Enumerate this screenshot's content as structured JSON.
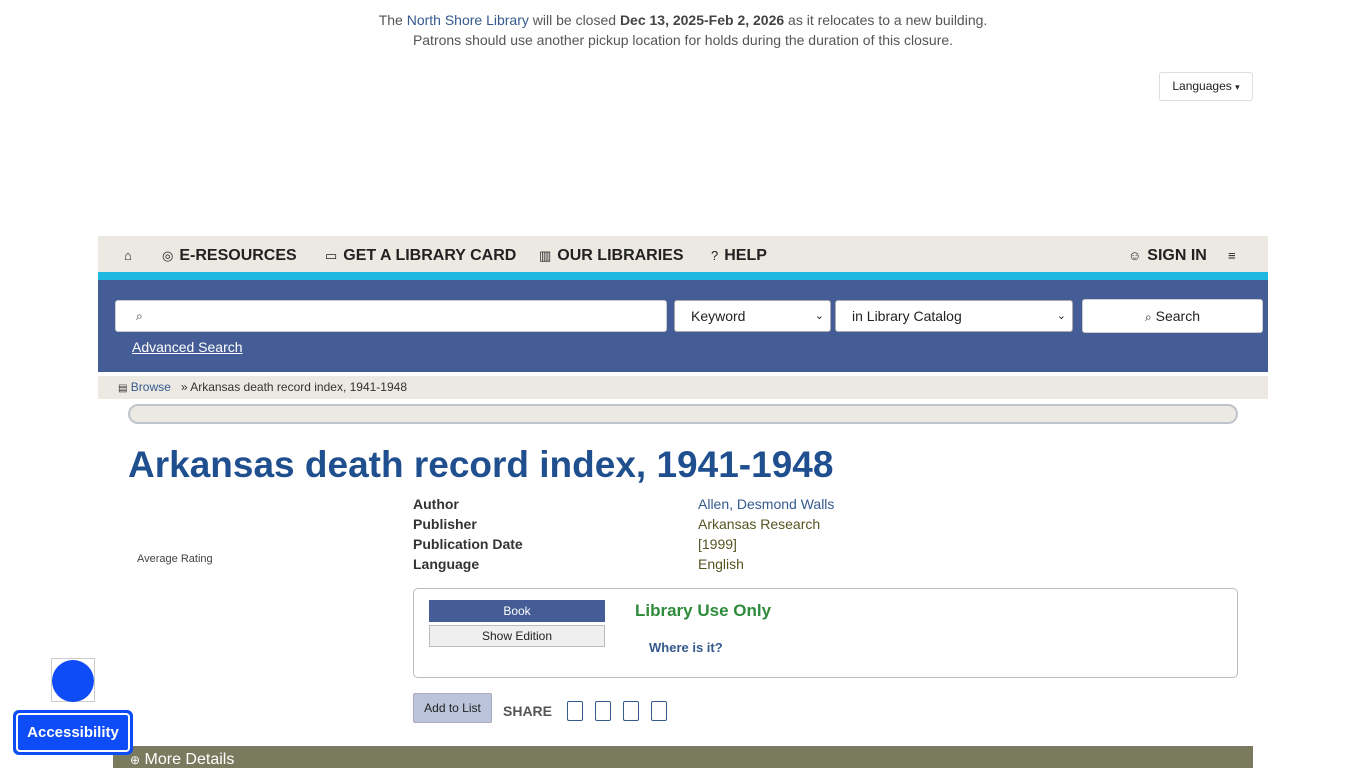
{
  "notice": {
    "line1_prefix": "The ",
    "line1_link": "North Shore Library",
    "line1_mid": " will be closed ",
    "line1_dates": "Dec 13, 2025-Feb 2, 2026",
    "line1_suffix": " as it relocates to a new building.",
    "line2": "Patrons should use another pickup location for holds during the duration of this closure."
  },
  "languages_label": "Languages",
  "nav": {
    "items": [
      {
        "label": "",
        "icon": "home-icon"
      },
      {
        "label": "E-RESOURCES",
        "icon": "globe-icon"
      },
      {
        "label": "GET A LIBRARY CARD",
        "icon": "card-icon"
      },
      {
        "label": "OUR LIBRARIES",
        "icon": "building-icon"
      },
      {
        "label": "HELP",
        "icon": "help-icon"
      }
    ],
    "sign_in": "SIGN IN",
    "extra_icon": "menu-icon"
  },
  "search": {
    "input_value": "",
    "search_type": "Keyword",
    "search_scope": "in Library Catalog",
    "button_label": "Search",
    "advanced_label": "Advanced Search"
  },
  "breadcrumb": {
    "browse": "Browse",
    "separator": "»",
    "current": "Arkansas death record index, 1941-1948"
  },
  "record": {
    "title": "Arkansas death record index, 1941-1948",
    "average_rating_label": "Average Rating",
    "fields": [
      {
        "label": "Author",
        "value": "Allen, Desmond Walls",
        "link": true
      },
      {
        "label": "Publisher",
        "value": "Arkansas Research",
        "link": false
      },
      {
        "label": "Publication Date",
        "value": "[1999]",
        "link": false
      },
      {
        "label": "Language",
        "value": "English",
        "link": false
      }
    ],
    "format_button": "Book",
    "edition_button": "Show Edition",
    "availability": "Library Use Only",
    "where_label": "Where is it?",
    "add_to_list": "Add to List",
    "share_label": "SHARE",
    "more_details": "More Details"
  },
  "accessibility_label": "Accessibility",
  "colors": {
    "nav_bg": "#ece9e3",
    "search_bg": "#445d96",
    "accent_cyan": "#1fb8e0",
    "title": "#1f4f8e",
    "available": "#2e8b3a",
    "accessibility": "#0d4cf6"
  }
}
